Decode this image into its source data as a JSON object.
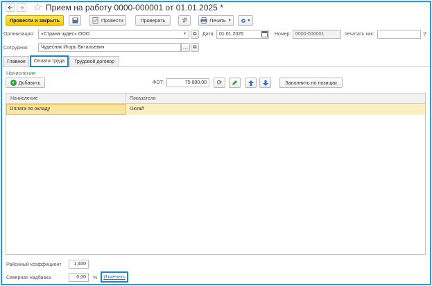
{
  "window": {
    "title": "Прием на работу 0000-000001 от 01.01.2025 *"
  },
  "toolbar": {
    "post_close": "Провести и закрыть",
    "post": "Провести",
    "check": "Проверить",
    "print": "Печать"
  },
  "header": {
    "org_label": "Организация:",
    "org_value": "«Страна чудес» ООО",
    "date_label": "Дата:",
    "date_value": "01.01.2025",
    "number_label": "Номер:",
    "number_value": "0000-000001",
    "print_as_label": "печатать как:",
    "help": "?",
    "employee_label": "Сотрудник:",
    "employee_value": "Чудесник Игорь Витальевич"
  },
  "tabs": [
    {
      "label": "Главное"
    },
    {
      "label": "Оплата труда"
    },
    {
      "label": "Трудовой договор"
    }
  ],
  "accruals": {
    "section_title": "Начисления",
    "add_label": "Добавить",
    "fot_label": "ФОТ:",
    "fot_value": "75 000,00",
    "fill_label": "Заполнить по позиции",
    "columns": [
      "Начисление",
      "Показатели"
    ],
    "rows": [
      {
        "name": "Оплата по окладу",
        "indicator": "Оклад"
      }
    ]
  },
  "footer": {
    "district_label": "Районный коэффициент",
    "district_value": "1,400",
    "north_label": "Северная надбавка",
    "north_value": "0,00",
    "percent": "%",
    "change_link": "Изменить"
  },
  "colors": {
    "accent": "#1aa0e0",
    "primary_button": "#f6c800",
    "selected_row": "#fdf0c0",
    "section_title": "#2ea043"
  }
}
